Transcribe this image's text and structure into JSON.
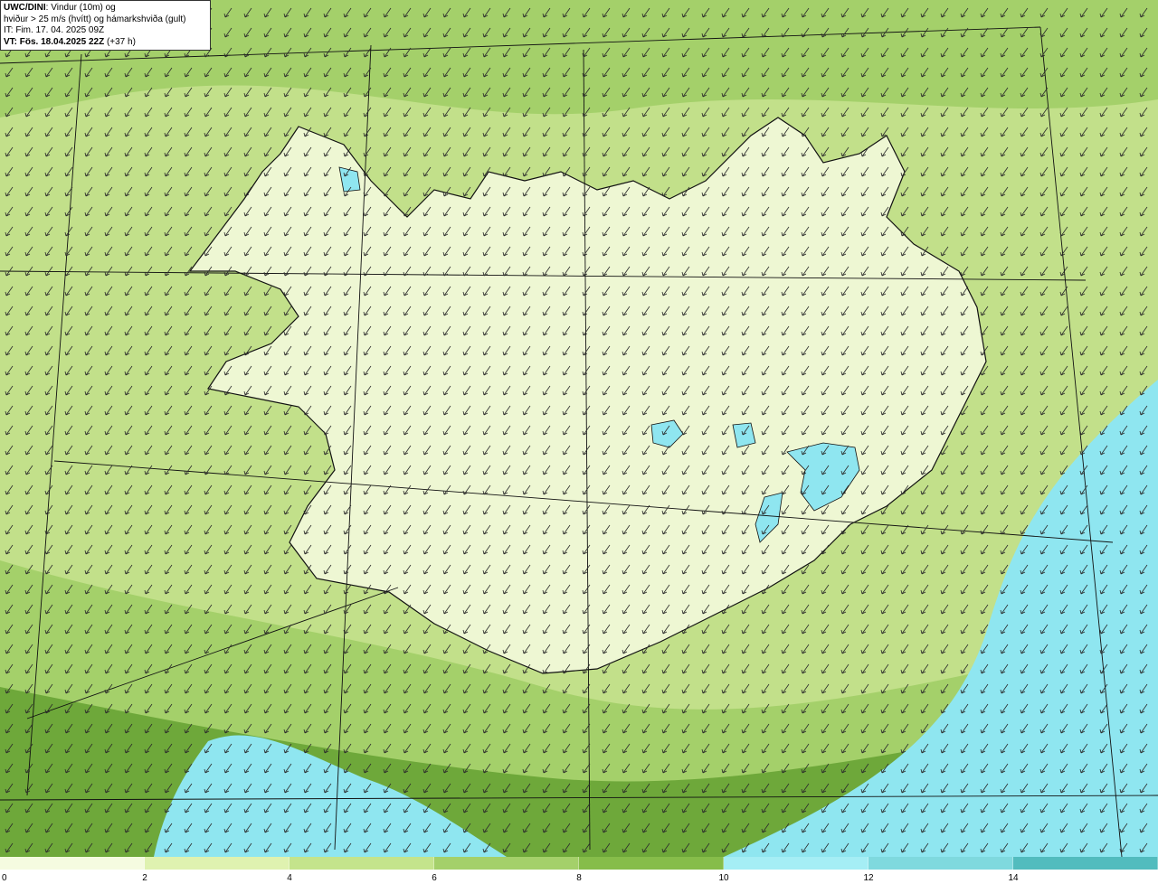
{
  "header": {
    "model_title": "UWC/DINI",
    "title_rest": ": Vindur (10m) og",
    "line2": "hviður > 25 m/s (hvítt) og hámarkshviða (gult)",
    "issue_time": "IT: Fim. 17. 04. 2025 09Z",
    "valid_label": "VT: Fös. 18.04.2025 22Z",
    "lead_time": "(+37 h)"
  },
  "legend": {
    "tick_labels": [
      "0",
      "2",
      "4",
      "6",
      "8",
      "10",
      "12",
      "14"
    ],
    "colors": [
      "#f5fbe0",
      "#dff2b0",
      "#c4e48c",
      "#a4d06a",
      "#86bd4a",
      "#a5eef5",
      "#7fd9de",
      "#52bcbe"
    ]
  },
  "map": {
    "land_fill": "#eef7d3",
    "sea_fill": "#c2e08a",
    "strong_fill": "#6ea83a",
    "ice_fill": "#8fe6f0",
    "coast_color": "#111111",
    "arrow_color": "#2b2b2b"
  }
}
